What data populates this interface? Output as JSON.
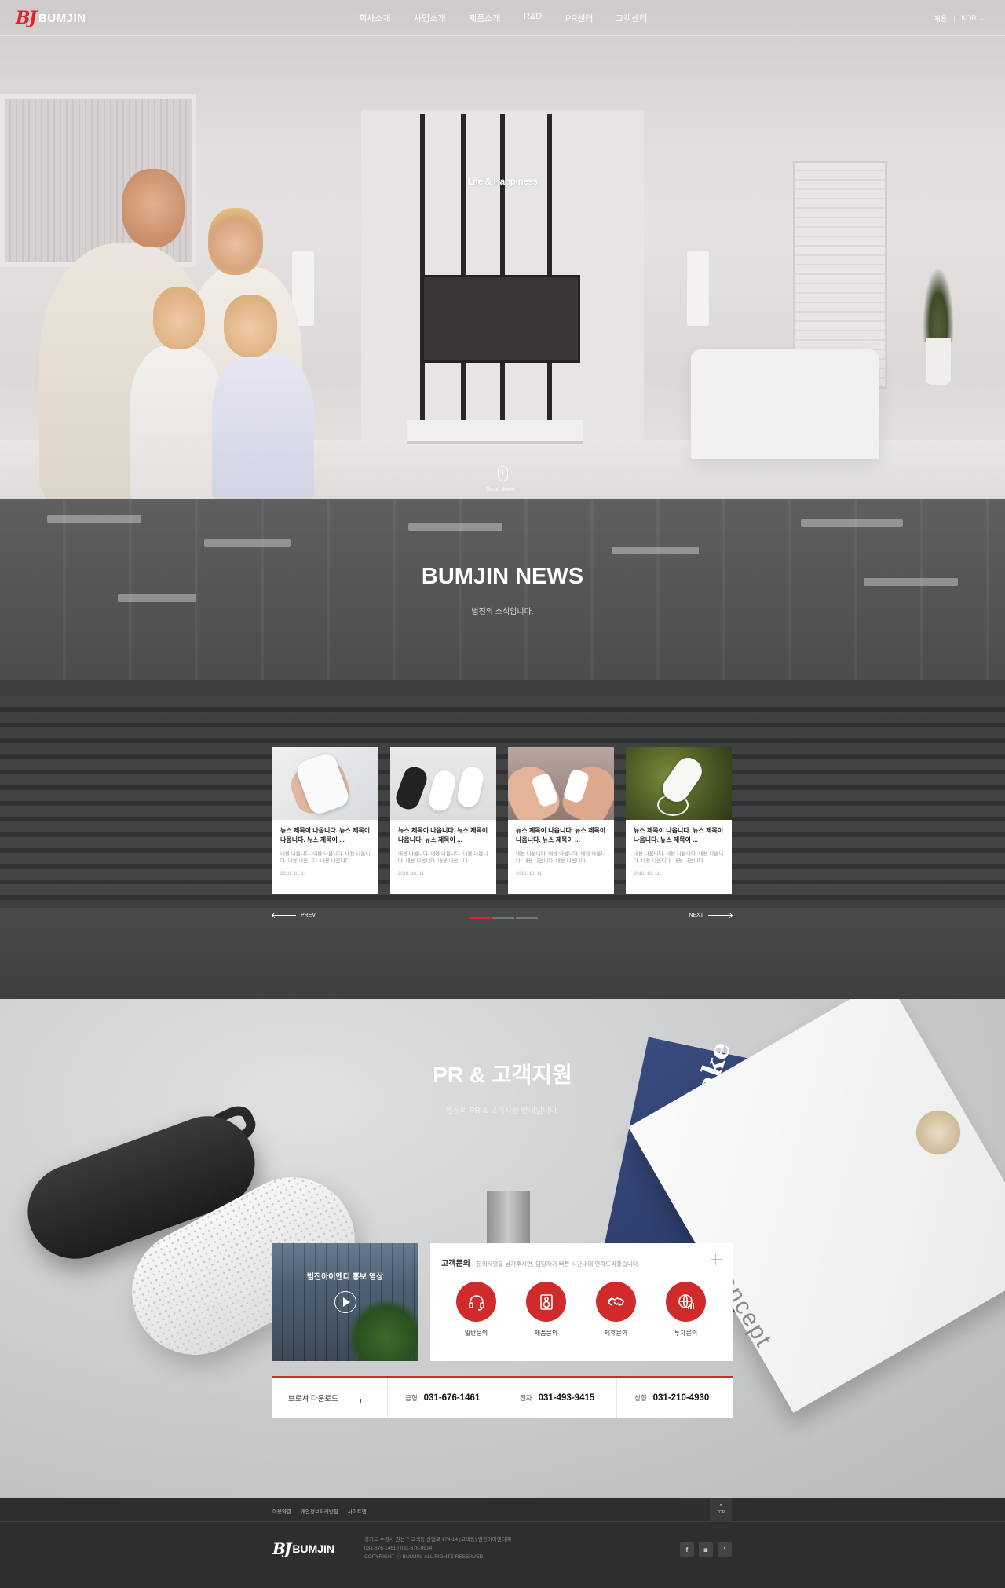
{
  "header": {
    "logo_mark": "BJ",
    "logo_text": "BUMJIN",
    "nav": [
      "회사소개",
      "사업소개",
      "제품소개",
      "R&D",
      "PR센터",
      "고객센터"
    ],
    "util_recruit": "채용",
    "util_sep": "|",
    "util_lang": "KOR"
  },
  "hero": {
    "tagline": "Life & Happiness",
    "scroll_label": "Scroll down"
  },
  "news": {
    "title": "BUMJIN NEWS",
    "subtitle": "범진의 소식입니다.",
    "cards": [
      {
        "title": "뉴스 제목이 나옵니다. 뉴스 제목이 나옵니다. 뉴스 제목이 ...",
        "desc": "내용 나옵니다. 내용 나옵니다. 내용 나옵니다. 내용 나옵니다. 내용 나옵니다.",
        "date": "2018. 10. 11"
      },
      {
        "title": "뉴스 제목이 나옵니다. 뉴스 제목이 나옵니다. 뉴스 제목이 ...",
        "desc": "내용 나옵니다. 내용 나옵니다. 내용 나옵니다. 내용 나옵니다. 내용 나옵니다.",
        "date": "2018. 10. 11"
      },
      {
        "title": "뉴스 제목이 나옵니다. 뉴스 제목이 나옵니다. 뉴스 제목이 ...",
        "desc": "내용 나옵니다. 내용 나옵니다. 내용 나옵니다. 내용 나옵니다. 내용 나옵니다.",
        "date": "2018. 10. 11"
      },
      {
        "title": "뉴스 제목이 나옵니다. 뉴스 제목이 나옵니다. 뉴스 제목이 ...",
        "desc": "내용 나옵니다. 내용 나옵니다. 내용 나옵니다. 내용 나옵니다. 내용 나옵니다.",
        "date": "2018. 10. 11"
      }
    ],
    "prev_label": "PREV",
    "next_label": "NEXT",
    "active_page": 1,
    "page_count": 3
  },
  "pr": {
    "title": "PR & 고객지원",
    "subtitle": "범진의 PR & 고객지원 안내입니다.",
    "video_title": "범진아이엔디 홍보 영상",
    "cs_title": "고객문의",
    "cs_desc": "문의사항을 남겨주시면, 담당자가 빠른 시간내에 연락드리겠습니다.",
    "cs_items": [
      {
        "label": "일반문의",
        "icon": "headset-icon"
      },
      {
        "label": "제품문의",
        "icon": "speaker-icon"
      },
      {
        "label": "제휴문의",
        "icon": "handshake-icon"
      },
      {
        "label": "투자문의",
        "icon": "globe-chart-icon"
      }
    ],
    "brochure_label": "브로셔 다운로드",
    "phones": [
      {
        "key": "금형",
        "value": "031-676-1461"
      },
      {
        "key": "전자",
        "value": "031-493-9415"
      },
      {
        "key": "성형",
        "value": "031-210-4930"
      }
    ]
  },
  "footer": {
    "links": [
      "이용약관",
      "개인정보처리방침",
      "사이트맵"
    ],
    "top_label": "TOP",
    "logo_mark": "BJ",
    "logo_text": "BUMJIN",
    "address": "경기도 수원시 권선구 고색동 산업로 174-14 (고색동) 범진아이엔디㈜",
    "tel_fax": "031-676-1461  |  031-676-0914",
    "copyright": "COPYRIGHT ⓒ BUMJIN. ALL RIGHTS RESERVED.",
    "sns": [
      "f",
      "ig",
      "blog"
    ]
  },
  "colors": {
    "accent": "#d02a2a",
    "footer_bg": "#2e2e2e"
  }
}
